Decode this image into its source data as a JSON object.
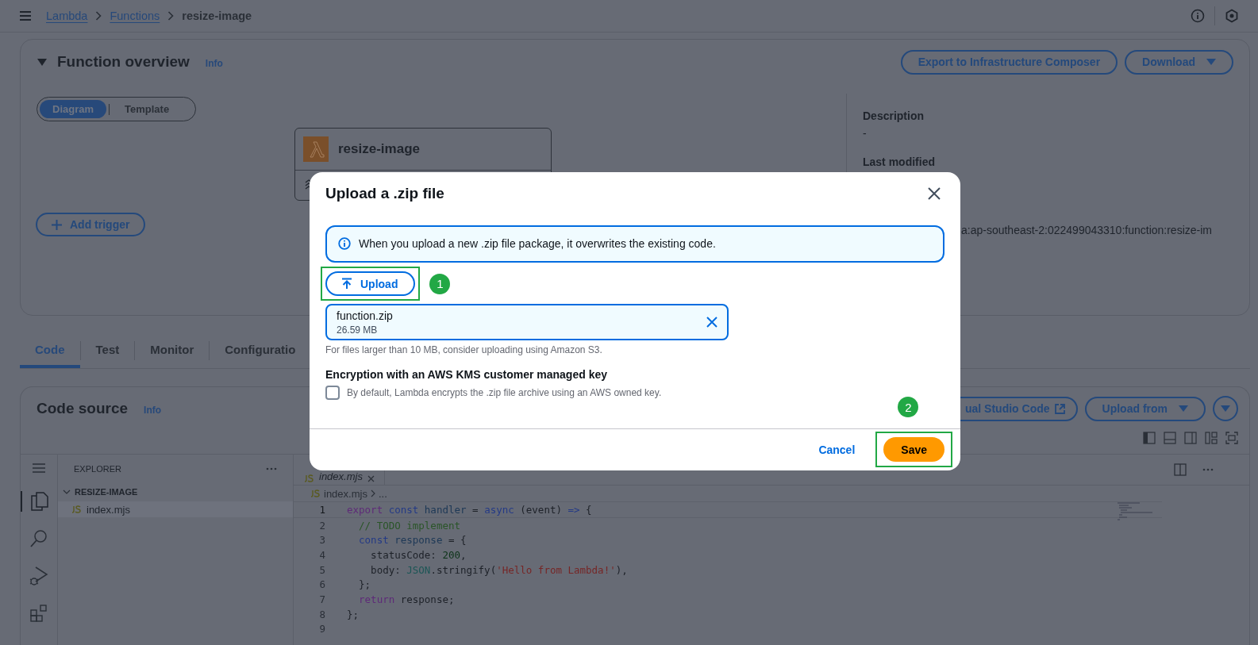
{
  "top_bar": {
    "breadcrumbs": [
      {
        "label": "Lambda",
        "link": true
      },
      {
        "label": "Functions",
        "link": true
      },
      {
        "label": "resize-image",
        "link": false
      }
    ]
  },
  "function_overview": {
    "title": "Function overview",
    "expanded": true,
    "info": "Info",
    "buttons": [
      {
        "label": "Export to Infrastructure Composer",
        "dropdown": false
      },
      {
        "label": "Download",
        "dropdown": true
      }
    ],
    "view_toggle": [
      {
        "label": "Diagram",
        "selected": true
      },
      {
        "label": "Template",
        "selected": false
      }
    ],
    "function_node": {
      "name": "resize-image"
    },
    "add_trigger": "Add trigger",
    "details": [
      {
        "kind": "field",
        "label": "Description",
        "value": "-"
      },
      {
        "kind": "field",
        "label": "Last modified"
      },
      {
        "kind": "partial",
        "value": "a:ap-southeast-2:022499043310:function:resize-im"
      }
    ]
  },
  "tabs": [
    {
      "label": "Code",
      "selected": true
    },
    {
      "label": "Test",
      "selected": false
    },
    {
      "label": "Monitor",
      "selected": false
    },
    {
      "label": "Configuratio",
      "selected": false
    }
  ],
  "code_source": {
    "title": "Code source",
    "info": "Info",
    "buttons": [
      {
        "kind": "external",
        "label": "ual Studio Code"
      },
      {
        "kind": "dropdown",
        "label": "Upload from"
      },
      {
        "kind": "menu"
      }
    ]
  },
  "explorer": {
    "title": "EXPLORER",
    "folder": {
      "name": "RESIZE-IMAGE",
      "expanded": true,
      "children": [
        {
          "name": "index.mjs",
          "selected": true
        }
      ]
    }
  },
  "editor": {
    "tab": "index.mjs",
    "breadcrumb": [
      "index.mjs",
      "..."
    ],
    "lines": [
      {
        "number": "1",
        "tokens": [
          {
            "kind": "keyword",
            "text": "export "
          },
          {
            "kind": "storage",
            "text": "const "
          },
          {
            "kind": "variable",
            "text": "handler "
          },
          {
            "kind": "plain",
            "text": "= "
          },
          {
            "kind": "storage",
            "text": "async "
          },
          {
            "kind": "plain",
            "text": "(event) "
          },
          {
            "kind": "storage",
            "text": "=> "
          },
          {
            "kind": "plain",
            "text": "{"
          }
        ]
      },
      {
        "number": "2",
        "tokens": [
          {
            "kind": "comment",
            "text": "  // TODO implement"
          }
        ]
      },
      {
        "number": "3",
        "tokens": [
          {
            "kind": "storage",
            "text": "  const "
          },
          {
            "kind": "variable",
            "text": "response "
          },
          {
            "kind": "plain",
            "text": "= {"
          }
        ]
      },
      {
        "number": "4",
        "tokens": [
          {
            "kind": "plain",
            "text": "    statusCode: "
          },
          {
            "kind": "number",
            "text": "200"
          },
          {
            "kind": "plain",
            "text": ","
          }
        ]
      },
      {
        "number": "5",
        "tokens": [
          {
            "kind": "plain",
            "text": "    body: "
          },
          {
            "kind": "type",
            "text": "JSON"
          },
          {
            "kind": "plain",
            "text": ".stringify("
          },
          {
            "kind": "string",
            "text": "'Hello from Lambda!'"
          },
          {
            "kind": "plain",
            "text": "),"
          }
        ]
      },
      {
        "number": "6",
        "tokens": [
          {
            "kind": "plain",
            "text": "  };"
          }
        ]
      },
      {
        "number": "7",
        "tokens": [
          {
            "kind": "keyword",
            "text": "  return "
          },
          {
            "kind": "plain",
            "text": "response;"
          }
        ]
      },
      {
        "number": "8",
        "tokens": [
          {
            "kind": "plain",
            "text": "};"
          }
        ]
      },
      {
        "number": "9"
      }
    ]
  },
  "modal": {
    "title": "Upload a .zip file",
    "alert": "When you upload a new .zip file package, it overwrites the existing code.",
    "upload_button": "Upload",
    "file": {
      "name": "function.zip",
      "size": "26.59 MB"
    },
    "help": "For files larger than 10 MB, consider uploading using Amazon S3.",
    "encryption": {
      "label": "Encryption with an AWS KMS customer managed key",
      "checkbox": "By default, Lambda encrypts the .zip file archive using an AWS owned key.",
      "checked": false
    },
    "buttons": [
      {
        "kind": "link",
        "label": "Cancel"
      },
      {
        "kind": "primary",
        "label": "Save"
      }
    ],
    "step_badges": [
      "1",
      "2"
    ]
  }
}
